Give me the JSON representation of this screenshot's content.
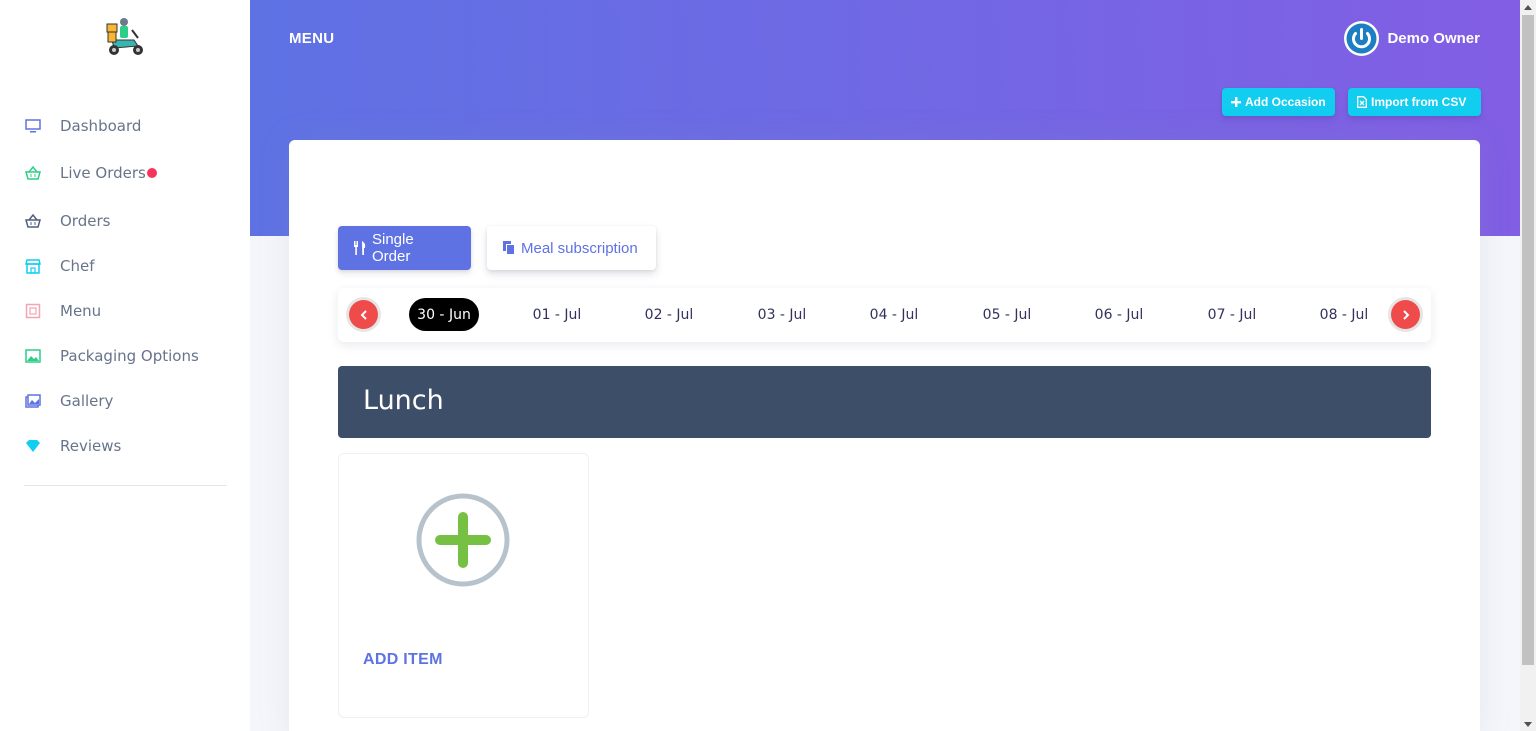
{
  "sidebar": {
    "logo_icon": "scooter-delivery-logo",
    "items": [
      {
        "label": "Dashboard",
        "icon": "monitor-icon",
        "color": "#5e72e4"
      },
      {
        "label": "Live Orders",
        "icon": "basket-icon",
        "color": "#2dce89",
        "badge": "live-indicator"
      },
      {
        "label": "Orders",
        "icon": "basket-icon",
        "color": "#525f7f"
      },
      {
        "label": "Chef",
        "icon": "shop-icon",
        "color": "#11cdef"
      },
      {
        "label": "Menu",
        "icon": "menu-icon",
        "color": "#f3a4b5"
      },
      {
        "label": "Packaging Options",
        "icon": "image-icon",
        "color": "#2dce89"
      },
      {
        "label": "Gallery",
        "icon": "album-icon",
        "color": "#5e72e4"
      },
      {
        "label": "Reviews",
        "icon": "diamond-icon",
        "color": "#11cdef"
      }
    ]
  },
  "header": {
    "title": "MENU",
    "user_name": "Demo Owner",
    "add_occasion_label": "Add Occasion",
    "import_csv_label": "Import from CSV"
  },
  "tabs": {
    "single_order": "Single Order",
    "meal_subscription": "Meal subscription",
    "active": "single_order"
  },
  "dates": {
    "items": [
      "30 - Jun",
      "01 - Jul",
      "02 - Jul",
      "03 - Jul",
      "04 - Jul",
      "05 - Jul",
      "06 - Jul",
      "07 - Jul",
      "08 - Jul"
    ],
    "selected": "30 - Jun"
  },
  "section": {
    "title": "Lunch"
  },
  "add_item": {
    "label": "ADD ITEM"
  },
  "colors": {
    "gradient_start": "#5e72e4",
    "gradient_end": "#825ee4",
    "primary": "#5e72e4",
    "info": "#11cdef",
    "danger": "#ef4b4b",
    "section_bar": "#3d4e69",
    "add_plus": "#76c043"
  }
}
